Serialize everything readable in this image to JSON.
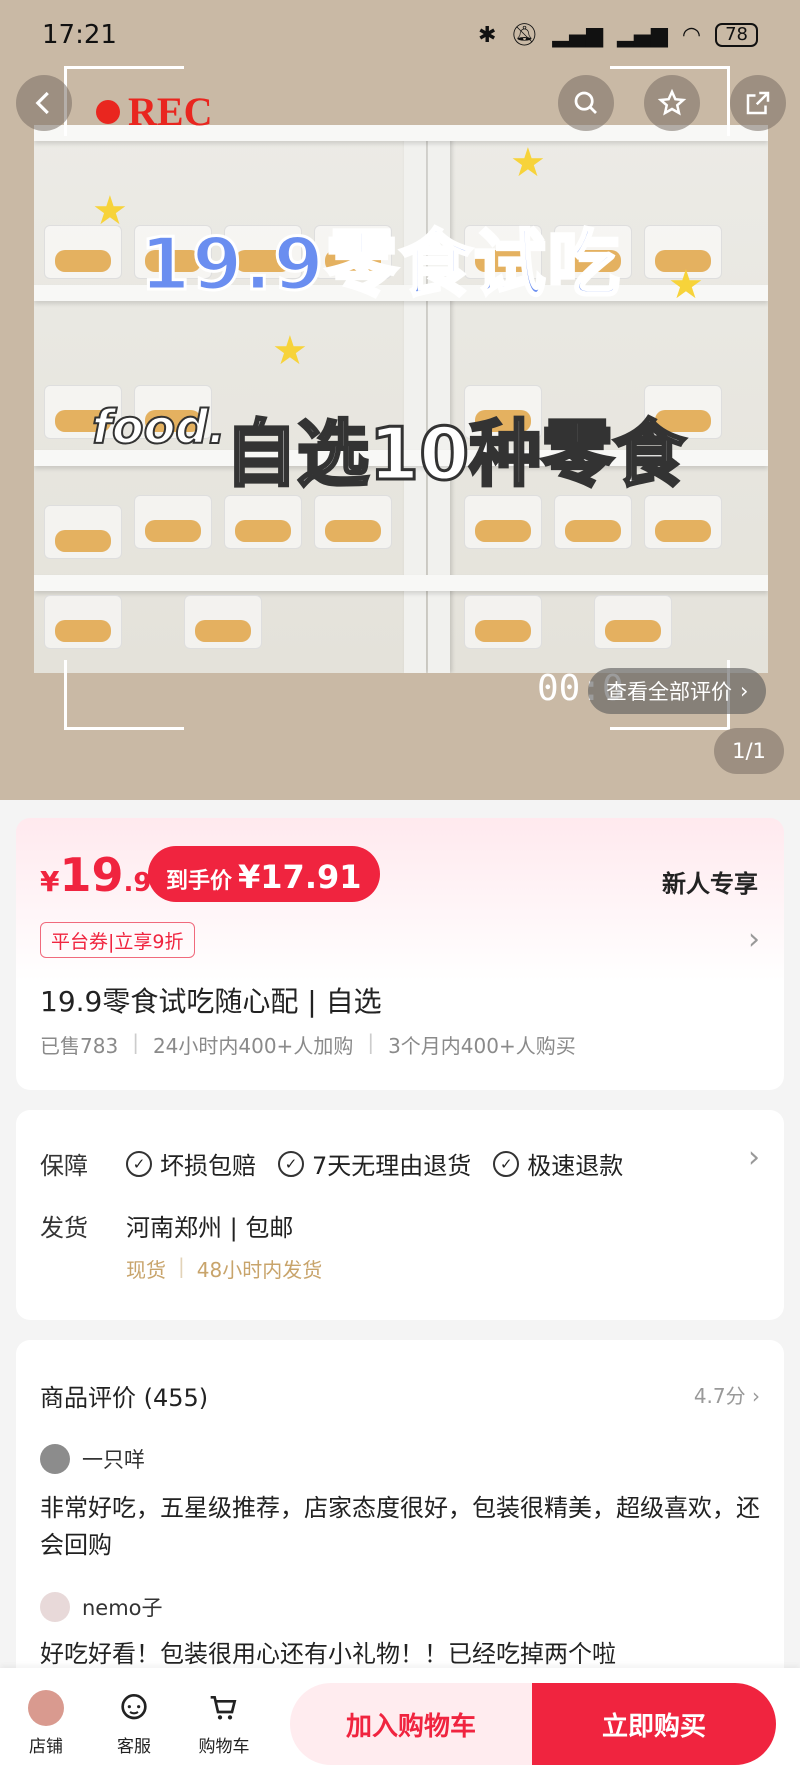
{
  "status": {
    "time": "17:21",
    "battery": "78"
  },
  "hero": {
    "rec_label": "REC",
    "overlay_title": "19.9零食试吃",
    "overlay_food": "food.",
    "overlay_sub": "自选10种零食",
    "rec_time": "00:0",
    "review_link": "查看全部评价",
    "page_indicator": "1/1"
  },
  "price": {
    "currency": "¥",
    "integer": "19",
    "decimal": ".9",
    "final_label": "到手价",
    "final_value": "¥17.91",
    "new_user": "新人专享",
    "coupon": "平台券|立享9折"
  },
  "product": {
    "title": "19.9零食试吃随心配 | 自选",
    "sales": [
      "已售783",
      "24小时内400+人加购",
      "3个月内400+人购买"
    ]
  },
  "guarantee": {
    "label": "保障",
    "items": [
      "坏损包赔",
      "7天无理由退货",
      "极速退款"
    ],
    "ship_label": "发货",
    "ship_value": "河南郑州 | 包邮",
    "ship_sub": [
      "现货",
      "48小时内发货"
    ]
  },
  "reviews": {
    "header": "商品评价 (455)",
    "score": "4.7分",
    "items": [
      {
        "user": "一只咩",
        "text": "非常好吃，五星级推荐，店家态度很好，包装很精美，超级喜欢，还会回购"
      },
      {
        "user": "nemo子",
        "text": "好吃好看！包装很用心还有小礼物！！已经吃掉两个啦"
      }
    ]
  },
  "bottom_bar": {
    "shop": "店铺",
    "service": "客服",
    "cart": "购物车",
    "add_to_cart": "加入购物车",
    "buy_now": "立即购买"
  },
  "colors": {
    "accent": "#f0243f",
    "hero_bg": "#c9b9a5",
    "ship_sub": "#c8a46b"
  }
}
